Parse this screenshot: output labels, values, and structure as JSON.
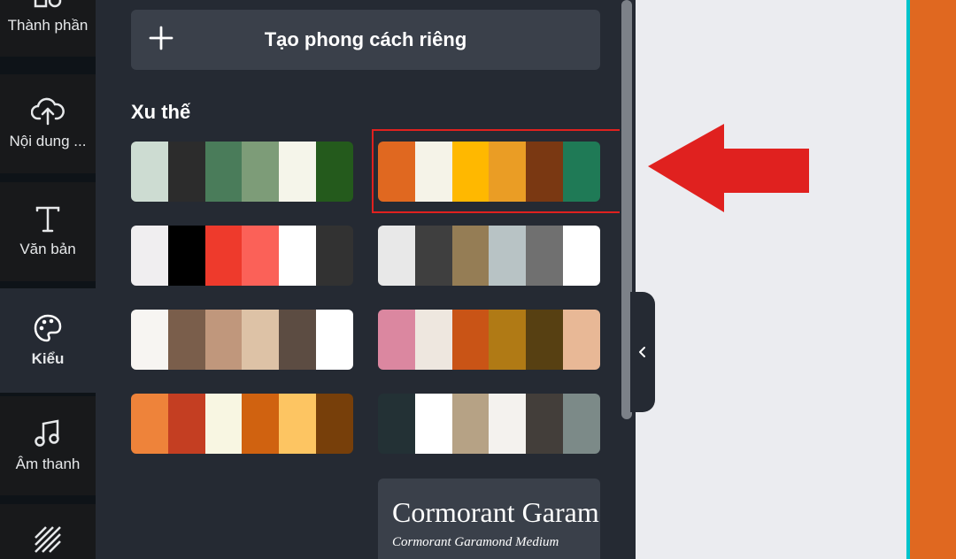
{
  "sidebar": {
    "items": [
      {
        "label": "Thành phần",
        "icon": "elements-icon"
      },
      {
        "label": "Nội dung ...",
        "icon": "upload-cloud-icon"
      },
      {
        "label": "Văn bản",
        "icon": "text-icon"
      },
      {
        "label": "Kiểu",
        "icon": "palette-icon",
        "active": true
      },
      {
        "label": "Âm thanh",
        "icon": "music-note-icon"
      },
      {
        "label": "",
        "icon": "background-pattern-icon"
      }
    ]
  },
  "panel": {
    "create_style_label": "Tạo phong cách riêng",
    "section_title": "Xu thế",
    "palettes": [
      [
        "#cddcd2",
        "#2c2c2c",
        "#4a7c5a",
        "#7d9c78",
        "#f5f5ea",
        "#245a1c"
      ],
      [
        "#e06820",
        "#f5f3e8",
        "#ffb800",
        "#ea9d25",
        "#7a3812",
        "#1f7a56"
      ],
      [
        "#f0eef0",
        "#000000",
        "#ee3a2c",
        "#fb6158",
        "#ffffff",
        "#323232"
      ],
      [
        "#e8e8e8",
        "#3f3f3f",
        "#957d55",
        "#b8c3c5",
        "#707070",
        "#ffffff"
      ],
      [
        "#f7f5f2",
        "#7a5e4b",
        "#c0977c",
        "#ddc2a6",
        "#5c4c42",
        "#ffffff"
      ],
      [
        "#db87a0",
        "#eee7df",
        "#c95416",
        "#b07a15",
        "#574012",
        "#e8b896"
      ],
      [
        "#ee833a",
        "#c43e22",
        "#f8f6e2",
        "#d06210",
        "#fdc562",
        "#773f0a"
      ],
      [
        "#233135",
        "#ffffff",
        "#b6a285",
        "#f4f2ee",
        "#433e3a",
        "#7c8a88"
      ]
    ],
    "font_card": {
      "heading": "Cormorant Garamond",
      "subheading": "Cormorant Garamond Medium"
    }
  },
  "colors": {
    "highlight": "#e0211f",
    "canvas_accent": "#e06820"
  }
}
